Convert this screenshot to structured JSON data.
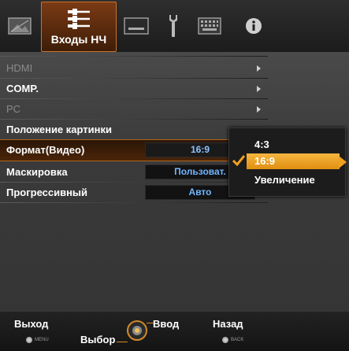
{
  "tabs": [
    {
      "name": "picture",
      "icon": "picture-icon"
    },
    {
      "name": "inputs",
      "icon": "connector-icon",
      "label": "Входы НЧ",
      "active": true
    },
    {
      "name": "screen",
      "icon": "screen-icon"
    },
    {
      "name": "setup",
      "icon": "wrench-icon"
    },
    {
      "name": "keyboard",
      "icon": "keyboard-icon"
    },
    {
      "name": "info",
      "icon": "info-icon"
    }
  ],
  "menu": {
    "items": [
      {
        "label": "HDMI",
        "enabled": false,
        "submenu": true
      },
      {
        "label": "COMP.",
        "enabled": true,
        "submenu": true
      },
      {
        "label": "PC",
        "enabled": false,
        "submenu": true
      },
      {
        "label": "Положение картинки",
        "enabled": true
      },
      {
        "label": "Формат(Видео)",
        "enabled": true,
        "selected": true,
        "value": "16:9"
      },
      {
        "label": "Маскировка",
        "enabled": true,
        "value": "Пользоват."
      },
      {
        "label": "Прогрессивный",
        "enabled": true,
        "value": "Авто"
      }
    ]
  },
  "popup": {
    "options": [
      "4:3",
      "16:9",
      "Увеличение"
    ],
    "selected": "16:9"
  },
  "navbar": {
    "exit": "Выход",
    "exit_key": "MENU",
    "select": "Выбор",
    "enter": "Ввод",
    "back": "Назад",
    "back_key": "BACK"
  },
  "colors": {
    "accent": "#e9a020",
    "value_text": "#6fb6ff",
    "active_tab": "#7a3a14"
  }
}
